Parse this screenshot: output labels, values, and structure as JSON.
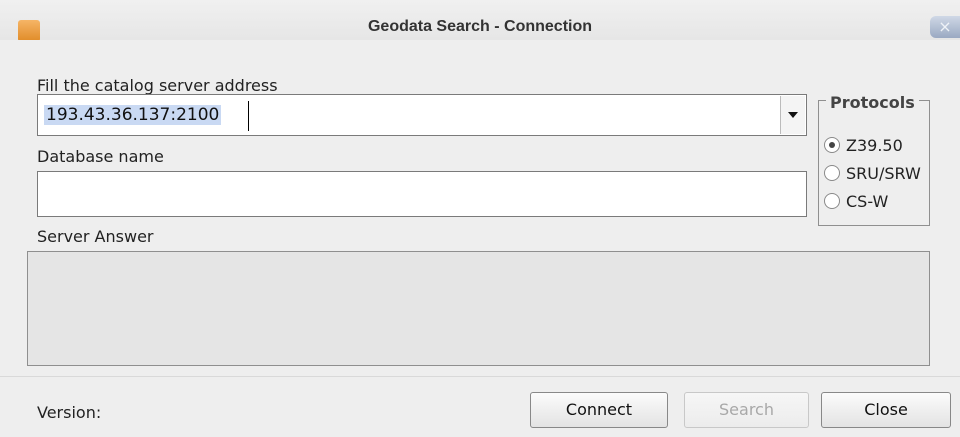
{
  "window": {
    "title": "Geodata Search - Connection",
    "close_glyph": "×",
    "app_icon": "app-icon"
  },
  "form": {
    "server_label": "Fill the catalog server address",
    "server_value": "193.43.36.137:2100",
    "database_label": "Database name",
    "database_value": "",
    "server_answer_label": "Server Answer",
    "version_label": "Version:"
  },
  "protocols": {
    "legend": "Protocols",
    "options": [
      "Z39.50",
      "SRU/SRW",
      "CS-W"
    ],
    "selected": "Z39.50"
  },
  "buttons": {
    "connect": "Connect",
    "search": "Search",
    "close": "Close",
    "search_enabled": false
  },
  "colors": {
    "accent_orange": "#e08a26",
    "selection": "#c9d9f3",
    "window_bg": "#eeeeee"
  }
}
